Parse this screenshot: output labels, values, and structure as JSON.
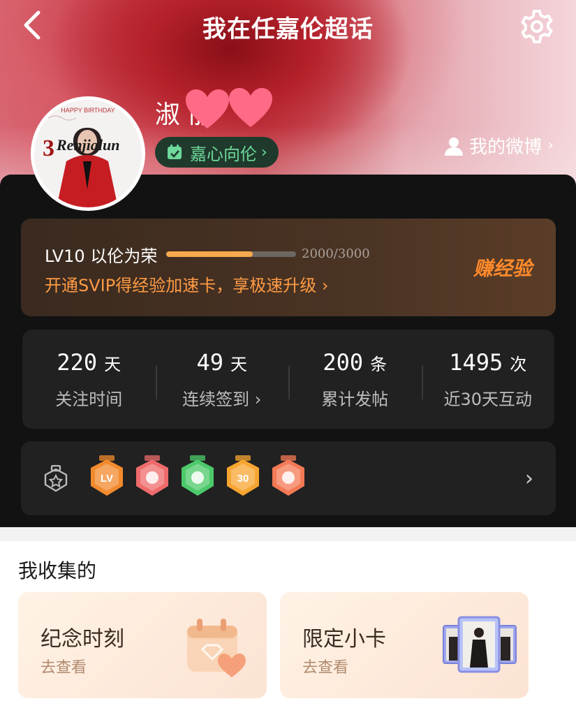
{
  "header": {
    "title": "我在任嘉伦超话"
  },
  "profile": {
    "username": "淑 丽",
    "title_chip": "嘉心向伦",
    "weibo_link": "我的微博",
    "avatar_text": "Renjialun",
    "avatar_caption": "HAPPY BIRTHDAY"
  },
  "level": {
    "name": "LV10 以伦为荣",
    "progress_text": "2000/3000",
    "progress_fraction": 0.6667,
    "promo": "开通SVIP得经验加速卡，享极速升级 ›",
    "earn_label": "赚经验"
  },
  "stats": [
    {
      "value": "220",
      "unit": "天",
      "label": "关注时间"
    },
    {
      "value": "49",
      "unit": "天",
      "label": "连续签到 ›"
    },
    {
      "value": "200",
      "unit": "条",
      "label": "累计发帖"
    },
    {
      "value": "1495",
      "unit": "次",
      "label": "近30天互动"
    }
  ],
  "badges": {
    "items": [
      {
        "name": "lv-badge",
        "color": "#f28a2e",
        "text": "LV"
      },
      {
        "name": "trophy-badge",
        "color": "#ef6b6b",
        "text": ""
      },
      {
        "name": "hand-badge",
        "color": "#4cc96a",
        "text": ""
      },
      {
        "name": "30-days-badge",
        "color": "#f7a531",
        "text": "30"
      },
      {
        "name": "rock-hand-badge",
        "color": "#f47a56",
        "text": ""
      }
    ]
  },
  "collection": {
    "title": "我收集的",
    "cards": [
      {
        "title": "纪念时刻",
        "sub": "去查看"
      },
      {
        "title": "限定小卡",
        "sub": "去查看"
      }
    ]
  },
  "colors": {
    "accent_orange": "#ff9b45",
    "chip_green": "#6ed99a",
    "dark_bg": "#121212"
  }
}
